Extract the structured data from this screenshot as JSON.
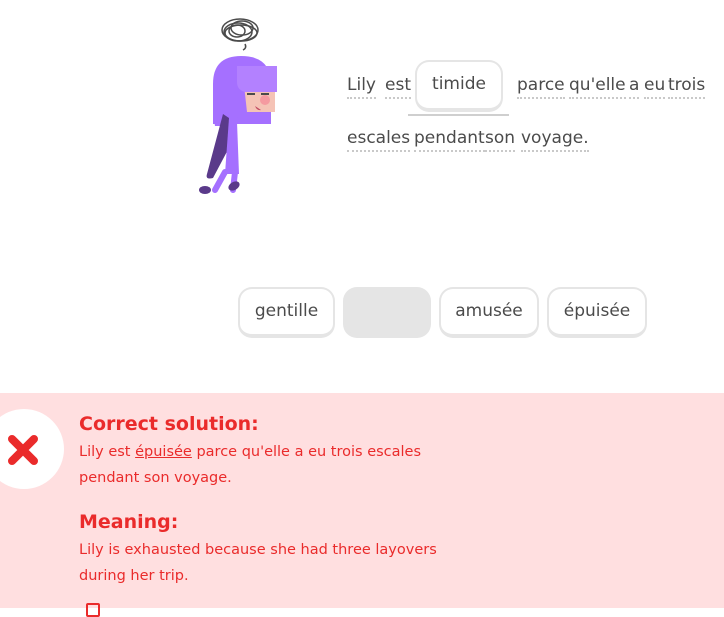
{
  "exercise": {
    "sentence_before": [
      "Lily",
      "est"
    ],
    "selected_answer": "timide",
    "sentence_after_line1": [
      "parce",
      "qu'elle",
      "a",
      "eu",
      "trois"
    ],
    "sentence_after_line2": [
      "escales",
      "pendant",
      "son",
      "voyage."
    ]
  },
  "word_bank": {
    "options": [
      "gentille",
      "",
      "amusée",
      "épuisée"
    ]
  },
  "feedback": {
    "status": "incorrect",
    "icon": "x-icon",
    "accent_color": "#ea2b2b",
    "background_color": "#ffdfe0",
    "solution_heading": "Correct solution:",
    "solution_prefix": "Lily est",
    "solution_highlight": "épuisée",
    "solution_suffix": " parce qu'elle a eu trois escales pendant son voyage.",
    "meaning_heading": "Meaning:",
    "meaning_text": "Lily is exhausted because she had three layovers during her trip."
  }
}
